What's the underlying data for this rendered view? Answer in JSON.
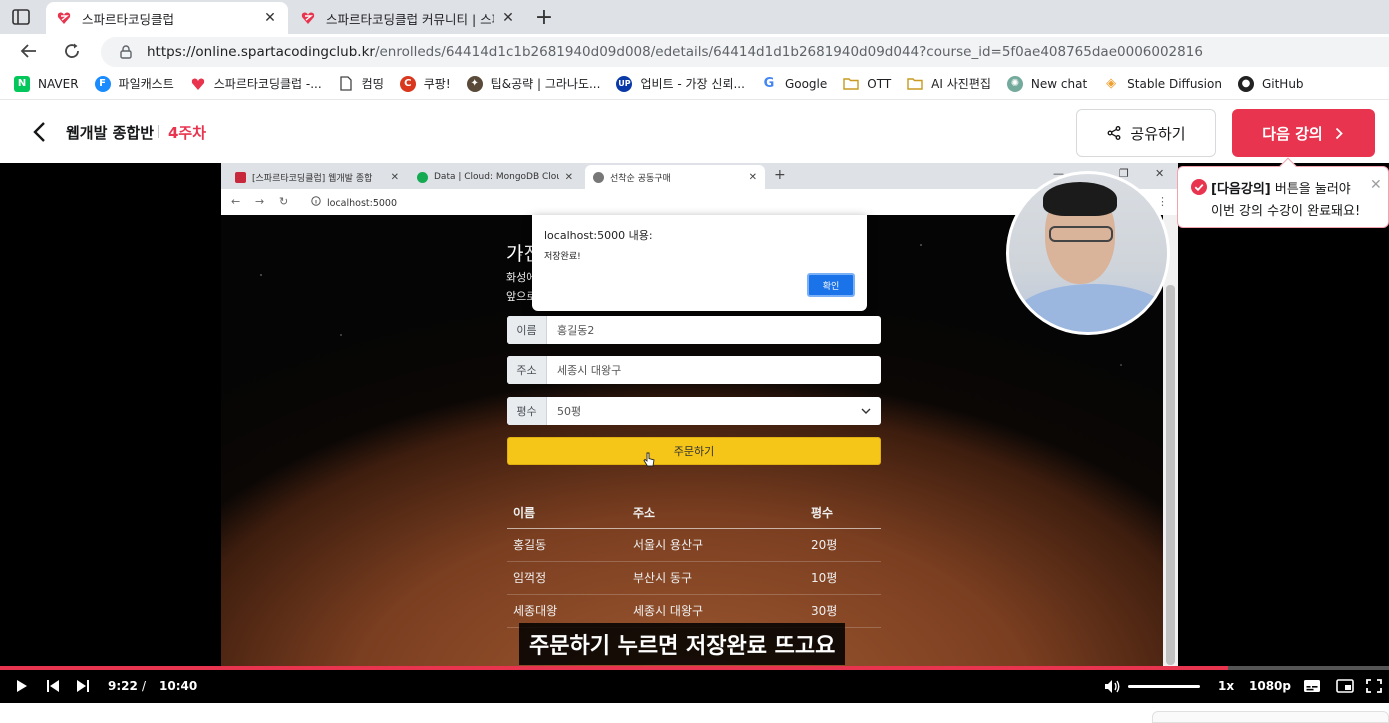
{
  "browser": {
    "tabs": [
      {
        "title": "스파르타코딩클럽",
        "active": true
      },
      {
        "title": "스파르타코딩클럽 커뮤니티 | 스파",
        "active": false
      }
    ],
    "url_host": "https://online.spartacodingclub.kr",
    "url_path": "/enrolleds/64414d1c1b2681940d09d008/edetails/64414d1d1b2681940d09d044?course_id=5f0ae408765dae0006002816",
    "bookmarks": [
      {
        "label": "NAVER",
        "icon": "naver-icon",
        "color": "#03c75a"
      },
      {
        "label": "파일캐스트",
        "icon": "filecast-icon",
        "color": "#1a8cff"
      },
      {
        "label": "스파르타코딩클럽 -...",
        "icon": "sparta-icon",
        "color": "#e8344e"
      },
      {
        "label": "컴띵",
        "icon": "page-icon",
        "color": "#666666"
      },
      {
        "label": "쿠팡!",
        "icon": "coupang-icon",
        "color": "#d9381e"
      },
      {
        "label": "팁&공략 | 그라나도...",
        "icon": "granado-icon",
        "color": "#5a4a3a"
      },
      {
        "label": "업비트 - 가장 신뢰...",
        "icon": "upbit-icon",
        "color": "#0a3aa8"
      },
      {
        "label": "Google",
        "icon": "google-icon",
        "color": "#4285f4"
      },
      {
        "label": "OTT",
        "icon": "folder-icon",
        "color": "#e7b53c"
      },
      {
        "label": "AI 사진편집",
        "icon": "folder-icon",
        "color": "#e7b53c"
      },
      {
        "label": "New chat",
        "icon": "chatgpt-icon",
        "color": "#74aa9c"
      },
      {
        "label": "Stable Diffusion",
        "icon": "stable-diffusion-icon",
        "color": "#f0a030"
      },
      {
        "label": "GitHub",
        "icon": "github-icon",
        "color": "#222222"
      }
    ]
  },
  "header": {
    "course_title": "웹개발 종합반",
    "week": "4주차",
    "share_label": "공유하기",
    "next_label": "다음 강의"
  },
  "tooltip": {
    "bold": "[다음강의]",
    "line1_rest": " 버튼을 눌러야",
    "line2": "이번 강의 수강이 완료돼요!"
  },
  "video": {
    "inner_tabs": [
      {
        "title": "[스파르타코딩클럽] 웹개발 종합",
        "active": false
      },
      {
        "title": "Data | Cloud: MongoDB Cloud",
        "active": false
      },
      {
        "title": "선착순 공동구매",
        "active": true
      }
    ],
    "inner_url": "localhost:5000",
    "page_heading": "가진",
    "page_sub1": "화성에",
    "page_sub2": "앞으로",
    "alert": {
      "title": "localhost:5000 내용:",
      "message": "저장완료!",
      "ok": "확인"
    },
    "form": [
      {
        "label": "이름",
        "value": "홍길동2"
      },
      {
        "label": "주소",
        "value": "세종시 대왕구"
      },
      {
        "label": "평수",
        "value": "50평"
      }
    ],
    "order_button": "주문하기",
    "table": {
      "headers": [
        "이름",
        "주소",
        "평수"
      ],
      "rows": [
        [
          "홍길동",
          "서울시 용산구",
          "20평"
        ],
        [
          "임꺽정",
          "부산시 동구",
          "10평"
        ],
        [
          "세종대왕",
          "세종시 대왕구",
          "30평"
        ]
      ]
    },
    "subtitle": "주문하기 누르면 저장완료 뜨고요"
  },
  "player": {
    "current_time": "9:22",
    "separator": "/",
    "total_time": "10:40",
    "speed": "1x",
    "quality": "1080p",
    "progress_fraction": 0.884,
    "accent": "#e8344e"
  }
}
